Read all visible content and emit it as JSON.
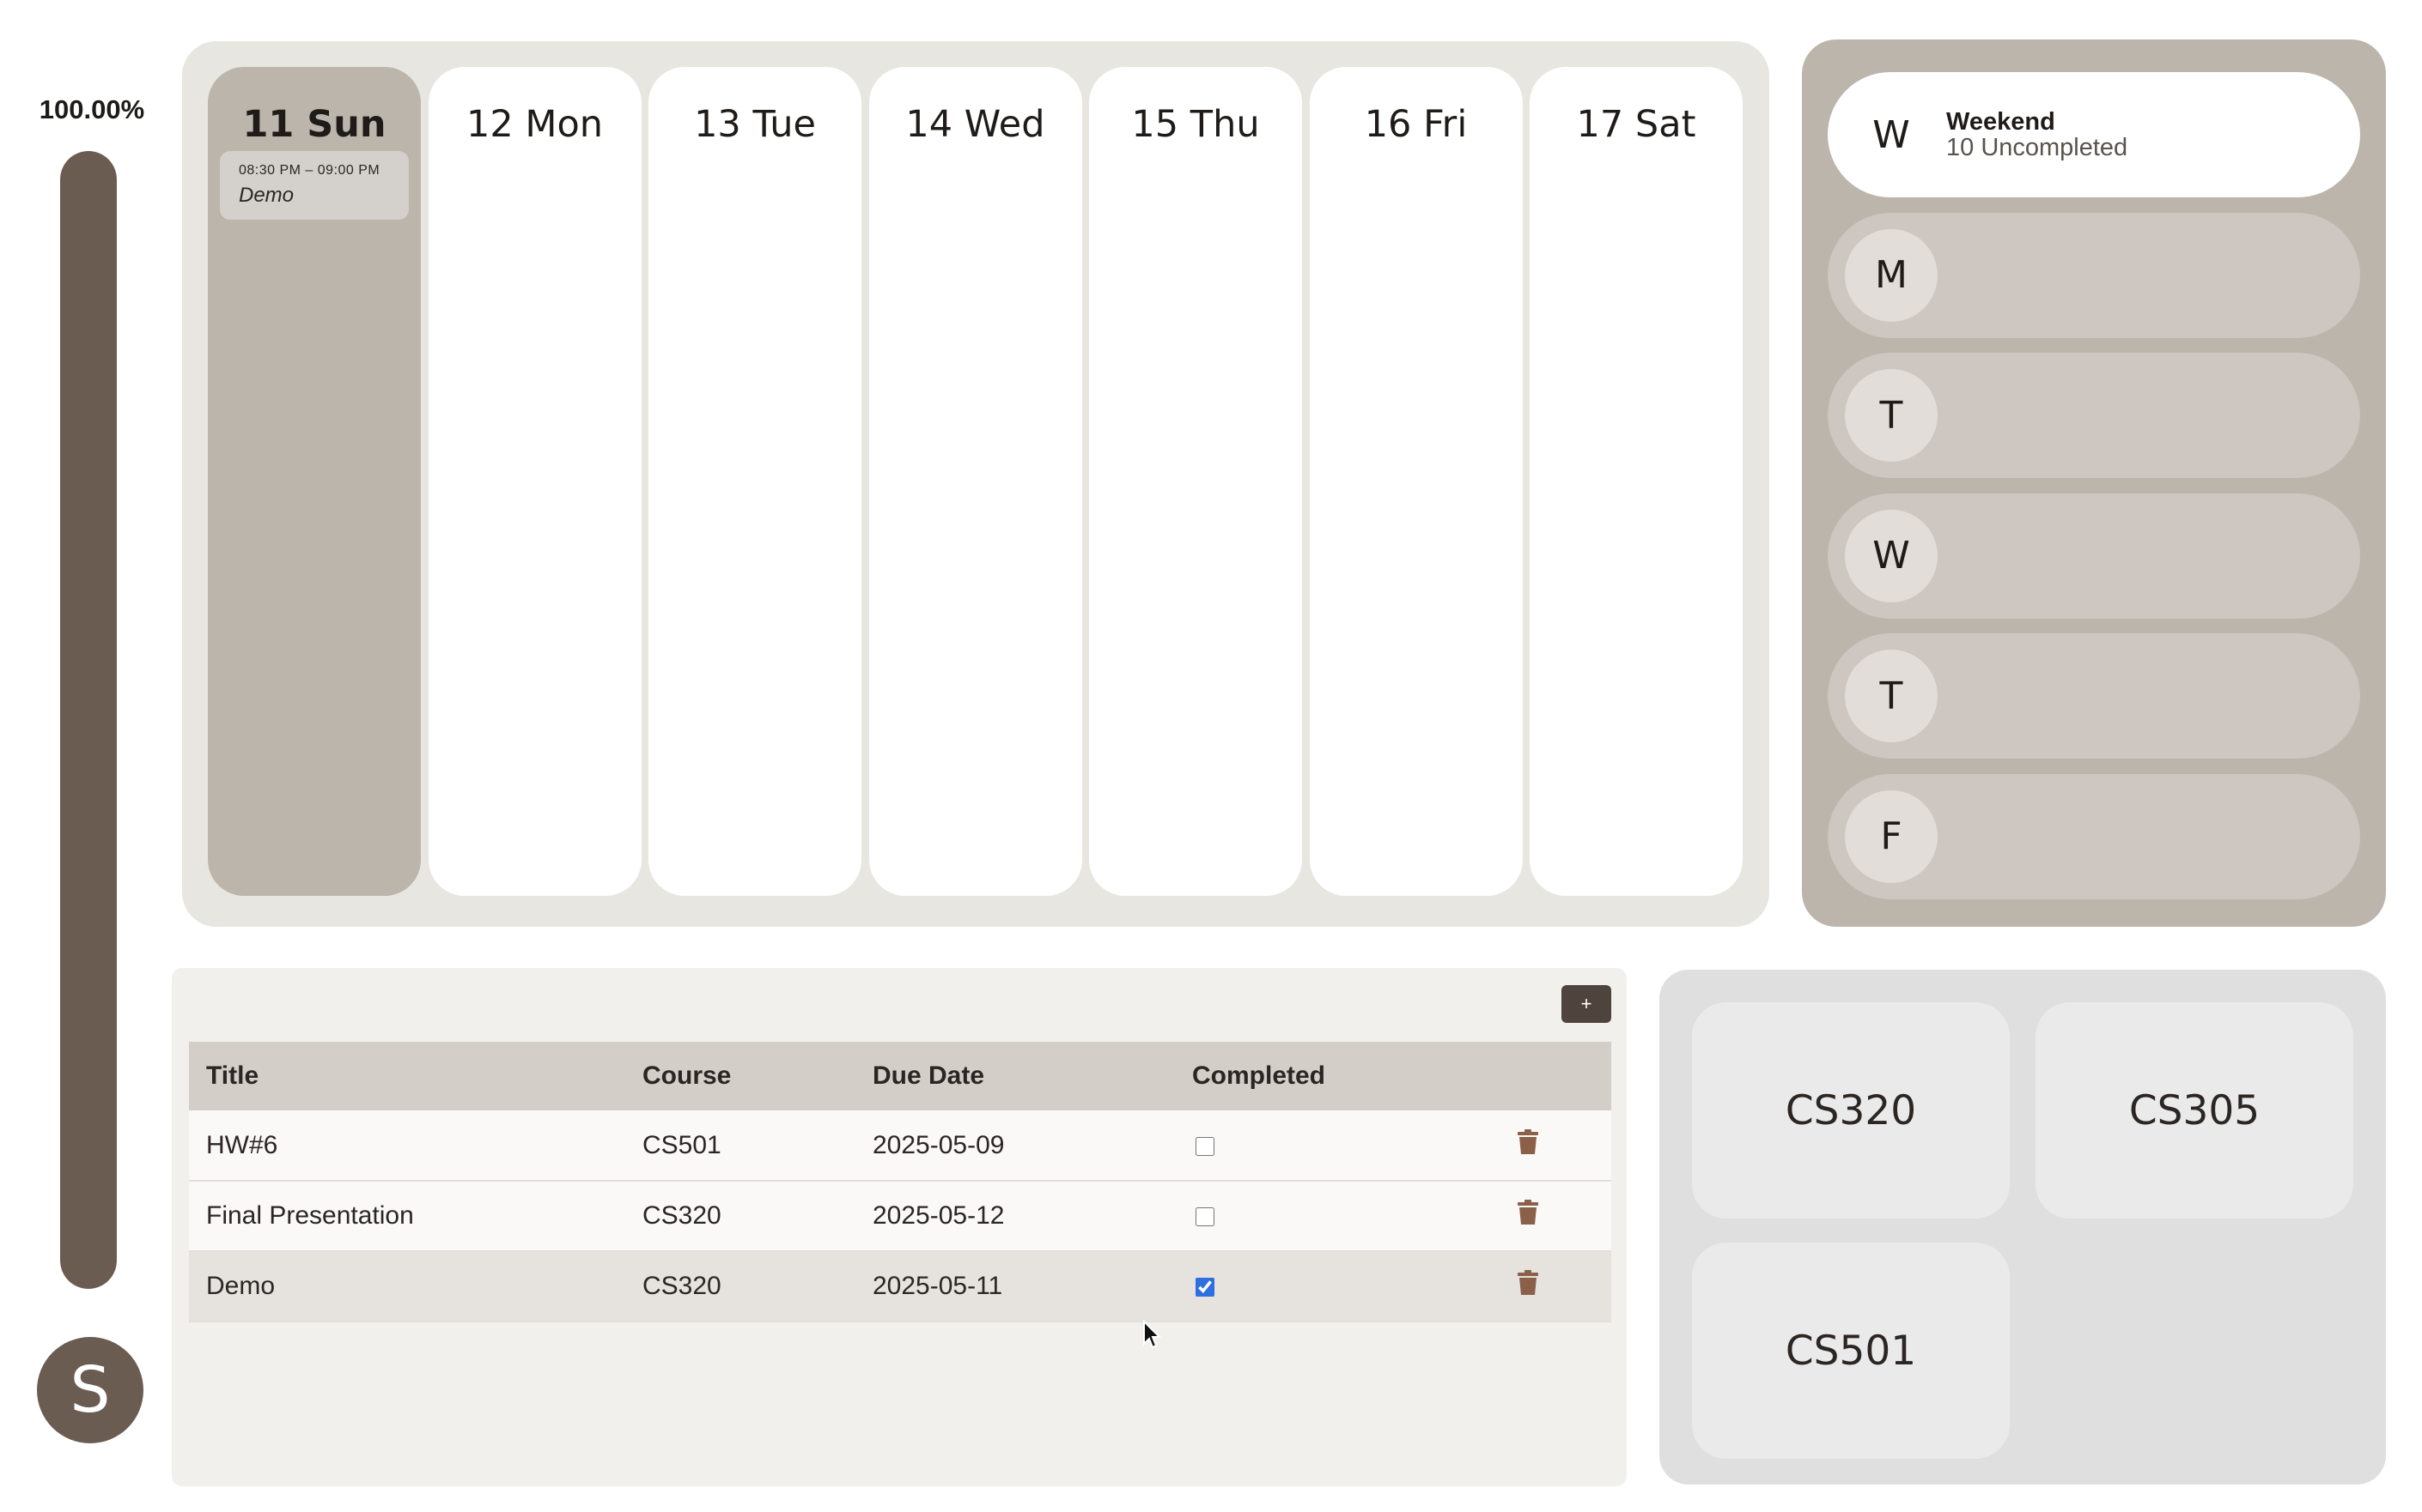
{
  "progress": {
    "label": "100.00%",
    "fraction": 1.0
  },
  "user": {
    "initial": "S"
  },
  "calendar": {
    "days": [
      {
        "label": "11 Sun",
        "today": true,
        "events": [
          {
            "time": "08:30 PM – 09:00 PM",
            "title": "Demo"
          }
        ]
      },
      {
        "label": "12 Mon",
        "today": false,
        "events": []
      },
      {
        "label": "13 Tue",
        "today": false,
        "events": []
      },
      {
        "label": "14 Wed",
        "today": false,
        "events": []
      },
      {
        "label": "15 Thu",
        "today": false,
        "events": []
      },
      {
        "label": "16 Fri",
        "today": false,
        "events": []
      },
      {
        "label": "17 Sat",
        "today": false,
        "events": []
      }
    ]
  },
  "weekdays": [
    {
      "letter": "W",
      "title": "Weekend",
      "subtitle": "10 Uncompleted",
      "active": true
    },
    {
      "letter": "M",
      "title": "",
      "subtitle": "",
      "active": false
    },
    {
      "letter": "T",
      "title": "",
      "subtitle": "",
      "active": false
    },
    {
      "letter": "W",
      "title": "",
      "subtitle": "",
      "active": false
    },
    {
      "letter": "T",
      "title": "",
      "subtitle": "",
      "active": false
    },
    {
      "letter": "F",
      "title": "",
      "subtitle": "",
      "active": false
    }
  ],
  "tasks": {
    "add_label": "+",
    "columns": [
      "Title",
      "Course",
      "Due Date",
      "Completed",
      ""
    ],
    "rows": [
      {
        "title": "HW#6",
        "course": "CS501",
        "due": "2025-05-09",
        "completed": false
      },
      {
        "title": "Final Presentation",
        "course": "CS320",
        "due": "2025-05-12",
        "completed": false
      },
      {
        "title": "Demo",
        "course": "CS320",
        "due": "2025-05-11",
        "completed": true
      }
    ]
  },
  "courses": [
    "CS320",
    "CS305",
    "CS501"
  ],
  "colors": {
    "accent": "#6b5c52",
    "trash": "#8a6048",
    "checkbox": "#2d6fe0"
  },
  "icons": {
    "delete": "trash-icon",
    "cursor": "mouse-pointer-icon"
  }
}
